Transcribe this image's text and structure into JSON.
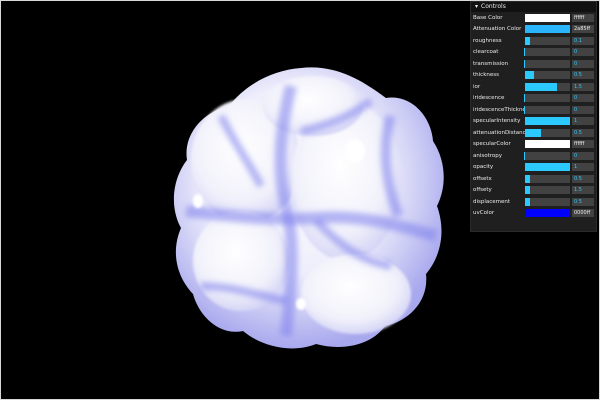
{
  "gui": {
    "title": "Controls",
    "rows": [
      {
        "label": "Base Color",
        "type": "color",
        "color": "#ffffff",
        "hex": "ffffff"
      },
      {
        "label": "Attenuation Color",
        "type": "color",
        "color": "#2bb5ff",
        "hex": "2a85ff"
      },
      {
        "label": "roughness",
        "type": "slider",
        "value": "0.1",
        "fill": 0.1
      },
      {
        "label": "clearcoat",
        "type": "slider",
        "value": "0",
        "fill": 0.0
      },
      {
        "label": "transmission",
        "type": "slider",
        "value": "0",
        "fill": 0.0
      },
      {
        "label": "thickness",
        "type": "slider",
        "value": "0.5",
        "fill": 0.2
      },
      {
        "label": "ior",
        "type": "slider",
        "value": "1.5",
        "fill": 0.7
      },
      {
        "label": "iridescence",
        "type": "slider",
        "value": "0",
        "fill": 0.0
      },
      {
        "label": "iridescenceThickness",
        "type": "slider",
        "value": "0",
        "fill": 0.0
      },
      {
        "label": "specularIntensity",
        "type": "slider",
        "value": "1",
        "fill": 1.0
      },
      {
        "label": "attenuationDistance",
        "type": "slider",
        "value": "0.5",
        "fill": 0.35
      },
      {
        "label": "specularColor",
        "type": "color",
        "color": "#ffffff",
        "hex": "ffffff"
      },
      {
        "label": "anisotropy",
        "type": "slider",
        "value": "0",
        "fill": 0.0
      },
      {
        "label": "opacity",
        "type": "slider",
        "value": "1",
        "fill": 1.0
      },
      {
        "label": "offsetx",
        "type": "slider",
        "value": "0.5",
        "fill": 0.1
      },
      {
        "label": "offsety",
        "type": "slider",
        "value": "1.5",
        "fill": 0.1
      },
      {
        "label": "displacement",
        "type": "slider",
        "value": "0.5",
        "fill": 0.12
      },
      {
        "label": "uvColor",
        "type": "color",
        "color": "#0000ff",
        "hex": "0000ff"
      }
    ]
  },
  "scene": {
    "object": "sphere-mesh",
    "base_color": "#ffffff",
    "tint_color": "#8a8cf0"
  }
}
